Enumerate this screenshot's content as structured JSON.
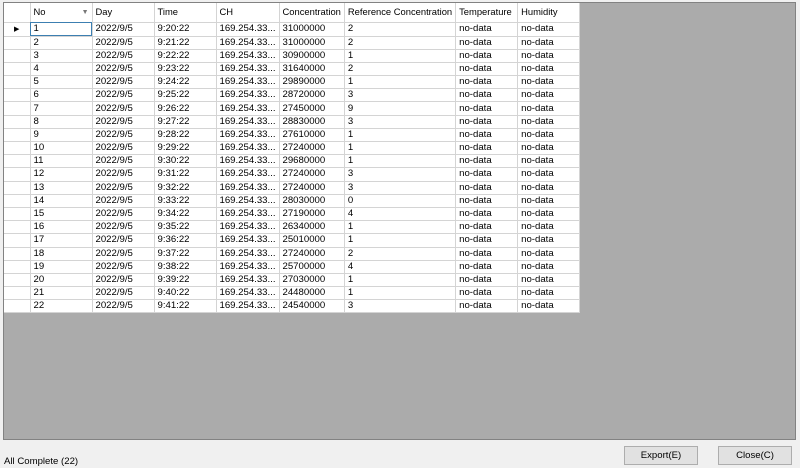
{
  "grid": {
    "columns": [
      "No",
      "Day",
      "Time",
      "CH",
      "Concentration",
      "Reference Concentration",
      "Temperature",
      "Humidity"
    ],
    "rows": [
      [
        "1",
        "2022/9/5",
        "9:20:22",
        "169.254.33...",
        "31000000",
        "2",
        "no-data",
        "no-data"
      ],
      [
        "2",
        "2022/9/5",
        "9:21:22",
        "169.254.33...",
        "31000000",
        "2",
        "no-data",
        "no-data"
      ],
      [
        "3",
        "2022/9/5",
        "9:22:22",
        "169.254.33...",
        "30900000",
        "1",
        "no-data",
        "no-data"
      ],
      [
        "4",
        "2022/9/5",
        "9:23:22",
        "169.254.33...",
        "31640000",
        "2",
        "no-data",
        "no-data"
      ],
      [
        "5",
        "2022/9/5",
        "9:24:22",
        "169.254.33...",
        "29890000",
        "1",
        "no-data",
        "no-data"
      ],
      [
        "6",
        "2022/9/5",
        "9:25:22",
        "169.254.33...",
        "28720000",
        "3",
        "no-data",
        "no-data"
      ],
      [
        "7",
        "2022/9/5",
        "9:26:22",
        "169.254.33...",
        "27450000",
        "9",
        "no-data",
        "no-data"
      ],
      [
        "8",
        "2022/9/5",
        "9:27:22",
        "169.254.33...",
        "28830000",
        "3",
        "no-data",
        "no-data"
      ],
      [
        "9",
        "2022/9/5",
        "9:28:22",
        "169.254.33...",
        "27610000",
        "1",
        "no-data",
        "no-data"
      ],
      [
        "10",
        "2022/9/5",
        "9:29:22",
        "169.254.33...",
        "27240000",
        "1",
        "no-data",
        "no-data"
      ],
      [
        "11",
        "2022/9/5",
        "9:30:22",
        "169.254.33...",
        "29680000",
        "1",
        "no-data",
        "no-data"
      ],
      [
        "12",
        "2022/9/5",
        "9:31:22",
        "169.254.33...",
        "27240000",
        "3",
        "no-data",
        "no-data"
      ],
      [
        "13",
        "2022/9/5",
        "9:32:22",
        "169.254.33...",
        "27240000",
        "3",
        "no-data",
        "no-data"
      ],
      [
        "14",
        "2022/9/5",
        "9:33:22",
        "169.254.33...",
        "28030000",
        "0",
        "no-data",
        "no-data"
      ],
      [
        "15",
        "2022/9/5",
        "9:34:22",
        "169.254.33...",
        "27190000",
        "4",
        "no-data",
        "no-data"
      ],
      [
        "16",
        "2022/9/5",
        "9:35:22",
        "169.254.33...",
        "26340000",
        "1",
        "no-data",
        "no-data"
      ],
      [
        "17",
        "2022/9/5",
        "9:36:22",
        "169.254.33...",
        "25010000",
        "1",
        "no-data",
        "no-data"
      ],
      [
        "18",
        "2022/9/5",
        "9:37:22",
        "169.254.33...",
        "27240000",
        "2",
        "no-data",
        "no-data"
      ],
      [
        "19",
        "2022/9/5",
        "9:38:22",
        "169.254.33...",
        "25700000",
        "4",
        "no-data",
        "no-data"
      ],
      [
        "20",
        "2022/9/5",
        "9:39:22",
        "169.254.33...",
        "27030000",
        "1",
        "no-data",
        "no-data"
      ],
      [
        "21",
        "2022/9/5",
        "9:40:22",
        "169.254.33...",
        "24480000",
        "1",
        "no-data",
        "no-data"
      ],
      [
        "22",
        "2022/9/5",
        "9:41:22",
        "169.254.33...",
        "24540000",
        "3",
        "no-data",
        "no-data"
      ]
    ],
    "current_row": 0,
    "sorted_column": 0
  },
  "status": {
    "text": "All Complete (22)"
  },
  "buttons": {
    "export_label": "Export(E)",
    "close_label": "Close(C)"
  },
  "icons": {
    "row_pointer": "row-pointer-icon",
    "sort": "sort-desc-icon"
  },
  "colors": {
    "selection_border": "#3c7fb1",
    "grid_background": "#ababab"
  }
}
